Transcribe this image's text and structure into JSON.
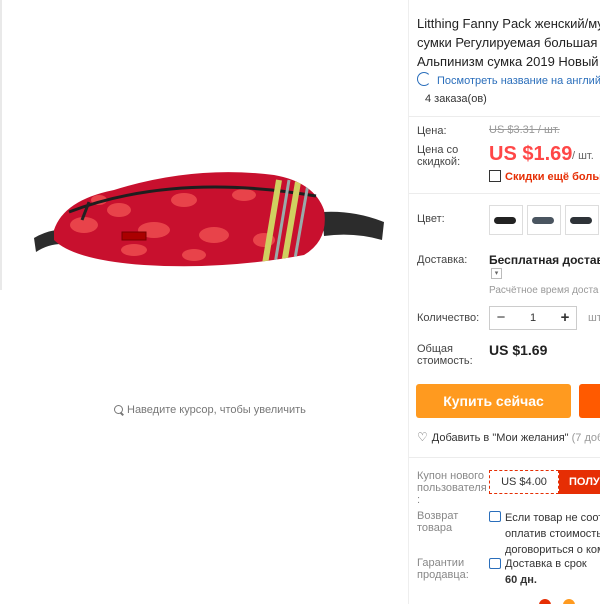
{
  "gallery": {
    "zoom_hint": "Наведите курсор, чтобы увеличить",
    "main_image": "fanny-pack-red-camo"
  },
  "product": {
    "title_lines": [
      "Litthing Fanny Pack женский/му",
      "сумки Регулируемая большая",
      "Альпинизм сумка 2019 Новый"
    ],
    "translate_link": "Посмотреть название на англий",
    "orders": "4 заказа(ов)"
  },
  "price": {
    "label": "Цена:",
    "old_value": "US $3.31 / шт.",
    "discount_label_line1": "Цена со",
    "discount_label_line2": "скидкой:",
    "new_value": "US $1.69",
    "unit": "/ шт.",
    "qr_discount": "Скидки ещё больше"
  },
  "color": {
    "label": "Цвет:",
    "swatches": [
      {
        "name": "black",
        "color": "#222222"
      },
      {
        "name": "grey-camo",
        "color": "#4a5560"
      },
      {
        "name": "dark-camo",
        "color": "#2e3338"
      }
    ]
  },
  "shipping": {
    "label": "Доставка:",
    "value": "Бесплатная доставка",
    "estimate": "Расчётное время доста"
  },
  "quantity": {
    "label": "Количество:",
    "value": "1",
    "minus": "−",
    "plus": "+",
    "unit": "шт."
  },
  "total": {
    "label_line1": "Общая",
    "label_line2": "стоимость:",
    "value": "US $1.69"
  },
  "actions": {
    "buy_now": "Купить сейчас",
    "wishlist": "Добавить в \"Мои желания\"",
    "wishlist_count": "(7 доб"
  },
  "coupon": {
    "label_line1": "Купон нового",
    "label_line2": "пользователя",
    "label_line3": ":",
    "value": "US $4.00",
    "button": "ПОЛУ"
  },
  "returns": {
    "label_line1": "Возврат",
    "label_line2": "товара",
    "text_line1": "Если товар не соотв",
    "text_line2": "оплатив стоимость",
    "text_line3": "договориться о ком"
  },
  "guarantee": {
    "label_line1": "Гарантии",
    "label_line2": "продавца:",
    "text_line1": "Доставка в срок",
    "text_line2": "60 дн."
  },
  "colors": {
    "accent_red": "#ff4747",
    "buy_orange": "#ff9a1f",
    "cart_orange": "#ff5a00",
    "link_blue": "#2a6ebb"
  }
}
